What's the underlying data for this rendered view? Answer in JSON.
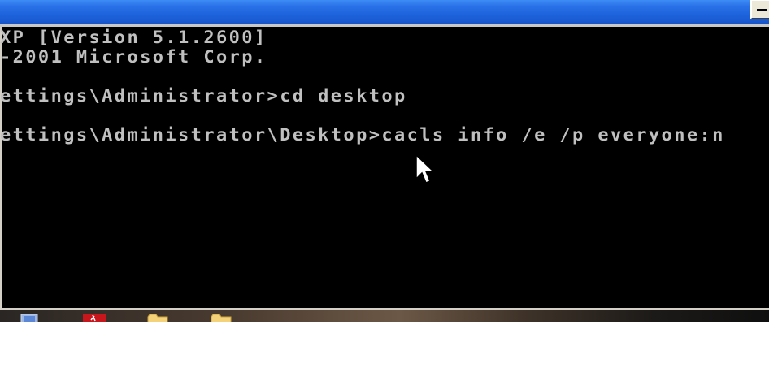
{
  "window": {
    "title_bar_color": "#1d63dc",
    "minimize_icon": "minimize-icon"
  },
  "console": {
    "background": "#000000",
    "text_color": "#c0c0c0",
    "lines": [
      "XP [Version 5.1.2600]",
      "-2001 Microsoft Corp.",
      "ettings\\Administrator>cd desktop",
      "ettings\\Administrator\\Desktop>cacls info /e /p everyone:n"
    ]
  },
  "desktop": {
    "icons": [
      "computer-icon",
      "pdf-icon",
      "folder-icon",
      "folder-icon"
    ]
  }
}
